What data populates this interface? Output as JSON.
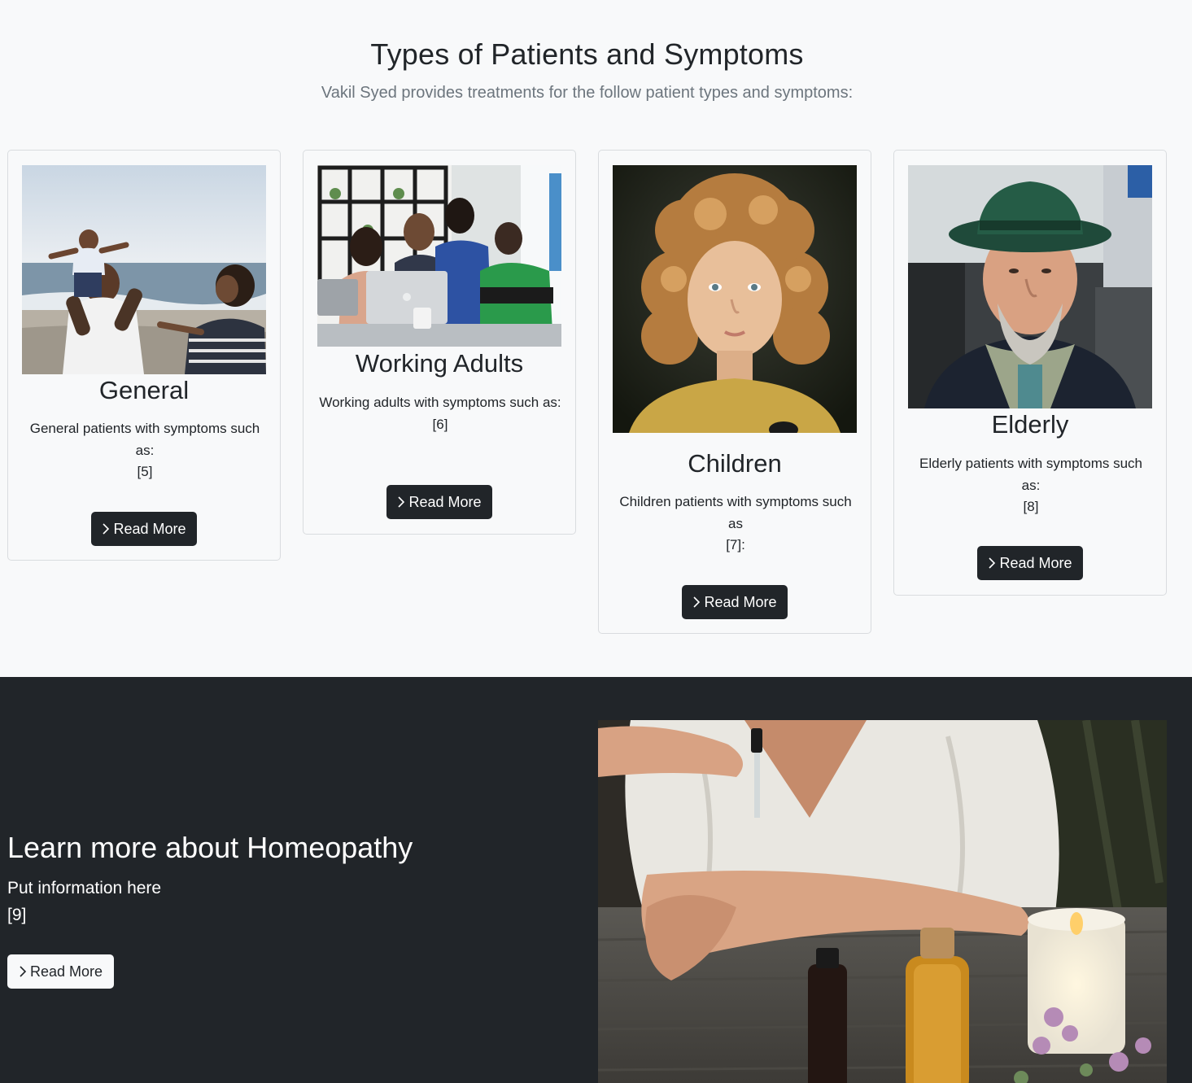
{
  "types_section": {
    "title": "Types of Patients and Symptoms",
    "subtitle": "Vakil Syed provides treatments for the follow patient types and symptoms:",
    "cards": [
      {
        "title": "General",
        "text_line1": "General patients with symptoms such as:",
        "text_line2": "[5]",
        "button_label": "Read More",
        "image": "family-beach-photo"
      },
      {
        "title": "Working Adults",
        "text_line1": "Working adults with symptoms such as:",
        "text_line2": "[6]",
        "button_label": "Read More",
        "image": "office-team-laptop-photo"
      },
      {
        "title": "Children",
        "text_line1": "Children patients with symptoms such as",
        "text_line2": "[7]:",
        "button_label": "Read More",
        "image": "curly-haired-child-photo"
      },
      {
        "title": "Elderly",
        "text_line1": "Elderly patients with symptoms such as:",
        "text_line2": "[8]",
        "button_label": "Read More",
        "image": "elderly-man-hat-photo"
      }
    ]
  },
  "learn_section": {
    "title": "Learn more about Homeopathy",
    "text_line1": "Put information here",
    "text_line2": "[9]",
    "button_label": "Read More",
    "image": "essential-oils-dropper-photo"
  },
  "icons": {
    "read_more": "chevron-right-icon"
  },
  "colors": {
    "dark": "#212529",
    "light": "#f8f9fa",
    "muted": "#6c757d"
  }
}
